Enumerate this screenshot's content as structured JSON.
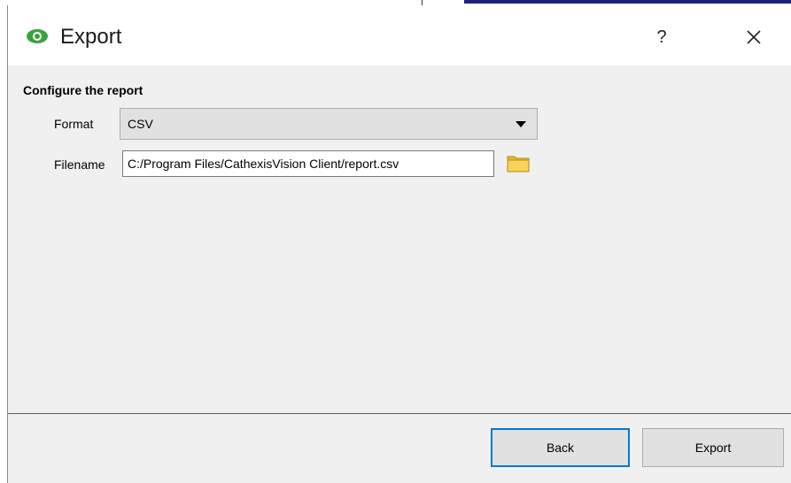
{
  "window": {
    "title": "Export",
    "help_label": "?",
    "icons": {
      "app": "eye-icon",
      "close": "close-icon"
    },
    "colors": {
      "app_icon": "#3aa33f",
      "accent_border": "#0078d7"
    }
  },
  "form": {
    "section_title": "Configure the report",
    "format": {
      "label": "Format",
      "selected": "CSV"
    },
    "filename": {
      "label": "Filename",
      "value": "C:/Program Files/CathexisVision Client/report.csv",
      "browse_icon": "folder-icon"
    }
  },
  "footer": {
    "back_label": "Back",
    "export_label": "Export"
  }
}
